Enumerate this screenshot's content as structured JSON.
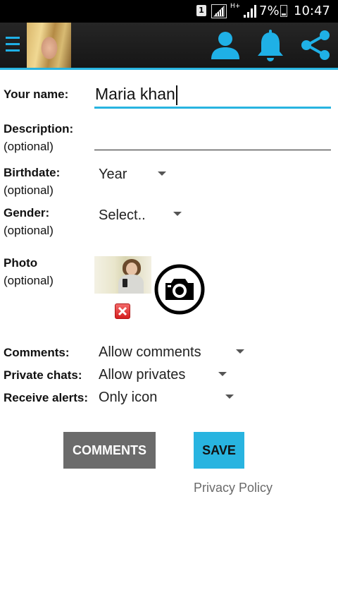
{
  "status_bar": {
    "sim_slot": "1",
    "network_type": "H+",
    "battery_percent": "7%",
    "time": "10:47"
  },
  "app_bar": {
    "menu_icon": "hamburger-menu-icon",
    "actions": [
      "user-icon",
      "bell-icon",
      "share-icon"
    ],
    "accent_color": "#28b4e0"
  },
  "form": {
    "name": {
      "label": "Your name:",
      "value": "Maria khan"
    },
    "description": {
      "label": "Description:",
      "optional": "(optional)",
      "value": ""
    },
    "birthdate": {
      "label": "Birthdate:",
      "optional": "(optional)",
      "selected": "Year"
    },
    "gender": {
      "label": "Gender:",
      "optional": "(optional)",
      "selected": "Select.."
    },
    "photo": {
      "label": "Photo",
      "optional": "(optional)"
    },
    "comments": {
      "label": "Comments:",
      "selected": "Allow comments"
    },
    "private_chats": {
      "label": "Private chats:",
      "selected": "Allow privates"
    },
    "receive_alerts": {
      "label": "Receive alerts:",
      "selected": "Only icon"
    }
  },
  "buttons": {
    "comments": "COMMENTS",
    "save": "SAVE",
    "comments_color": "#6b6b6b",
    "save_color": "#28b4e0"
  },
  "links": {
    "privacy_policy": "Privacy Policy"
  }
}
